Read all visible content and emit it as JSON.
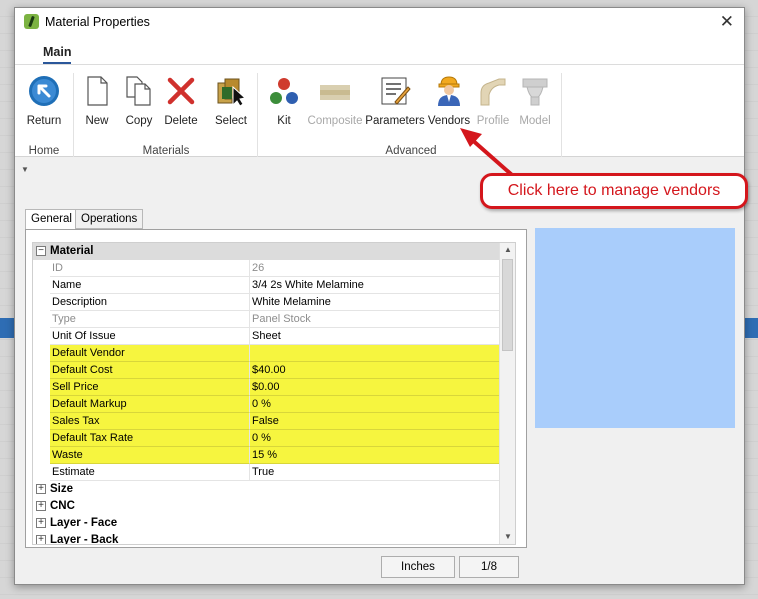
{
  "window": {
    "title": "Material Properties",
    "close_glyph": "✕"
  },
  "tabs": {
    "main": "Main"
  },
  "ribbon": {
    "home": {
      "group_label": "Home",
      "buttons": [
        {
          "label": "Return",
          "icon": "return-icon"
        }
      ]
    },
    "materials": {
      "group_label": "Materials",
      "buttons": [
        {
          "label": "New",
          "icon": "new-document-icon"
        },
        {
          "label": "Copy",
          "icon": "copy-icon"
        },
        {
          "label": "Delete",
          "icon": "delete-icon"
        },
        {
          "label": "Select",
          "icon": "select-icon"
        }
      ]
    },
    "advanced": {
      "group_label": "Advanced",
      "buttons": [
        {
          "label": "Kit",
          "icon": "kit-icon",
          "enabled": true
        },
        {
          "label": "Composite",
          "icon": "composite-icon",
          "enabled": false
        },
        {
          "label": "Parameters",
          "icon": "parameters-icon",
          "enabled": true
        },
        {
          "label": "Vendors",
          "icon": "vendors-icon",
          "enabled": true
        },
        {
          "label": "Profile",
          "icon": "profile-icon",
          "enabled": false
        },
        {
          "label": "Model",
          "icon": "model-icon",
          "enabled": false
        }
      ]
    }
  },
  "property_tabs": [
    {
      "label": "General",
      "active": true
    },
    {
      "label": "Operations",
      "active": false
    }
  ],
  "grid": {
    "category": "Material",
    "rows": [
      {
        "key": "ID",
        "value": "26",
        "readonly": true,
        "highlight": false
      },
      {
        "key": "Name",
        "value": "3/4 2s White Melamine",
        "readonly": false,
        "highlight": false
      },
      {
        "key": "Description",
        "value": "White Melamine",
        "readonly": false,
        "highlight": false
      },
      {
        "key": "Type",
        "value": "Panel Stock",
        "readonly": true,
        "highlight": false
      },
      {
        "key": "Unit Of Issue",
        "value": "Sheet",
        "readonly": false,
        "highlight": false
      },
      {
        "key": "Default Vendor",
        "value": "",
        "readonly": false,
        "highlight": true
      },
      {
        "key": "Default Cost",
        "value": "$40.00",
        "readonly": false,
        "highlight": true
      },
      {
        "key": "Sell Price",
        "value": "$0.00",
        "readonly": false,
        "highlight": true
      },
      {
        "key": "Default Markup",
        "value": "0 %",
        "readonly": false,
        "highlight": true
      },
      {
        "key": "Sales Tax",
        "value": "False",
        "readonly": false,
        "highlight": true
      },
      {
        "key": "Default Tax Rate",
        "value": "0 %",
        "readonly": false,
        "highlight": true
      },
      {
        "key": "Waste",
        "value": "15 %",
        "readonly": false,
        "highlight": true
      },
      {
        "key": "Estimate",
        "value": "True",
        "readonly": false,
        "highlight": false
      }
    ],
    "collapsed_categories": [
      "Size",
      "CNC",
      "Layer - Face",
      "Layer - Back"
    ]
  },
  "status": {
    "units": "Inches",
    "precision": "1/8"
  },
  "annotation": {
    "text": "Click here to manage vendors",
    "color": "#d4161c"
  },
  "colors": {
    "highlight": "#f6f53f",
    "preview": "#a9cdfb",
    "accent": "#2b579a"
  }
}
